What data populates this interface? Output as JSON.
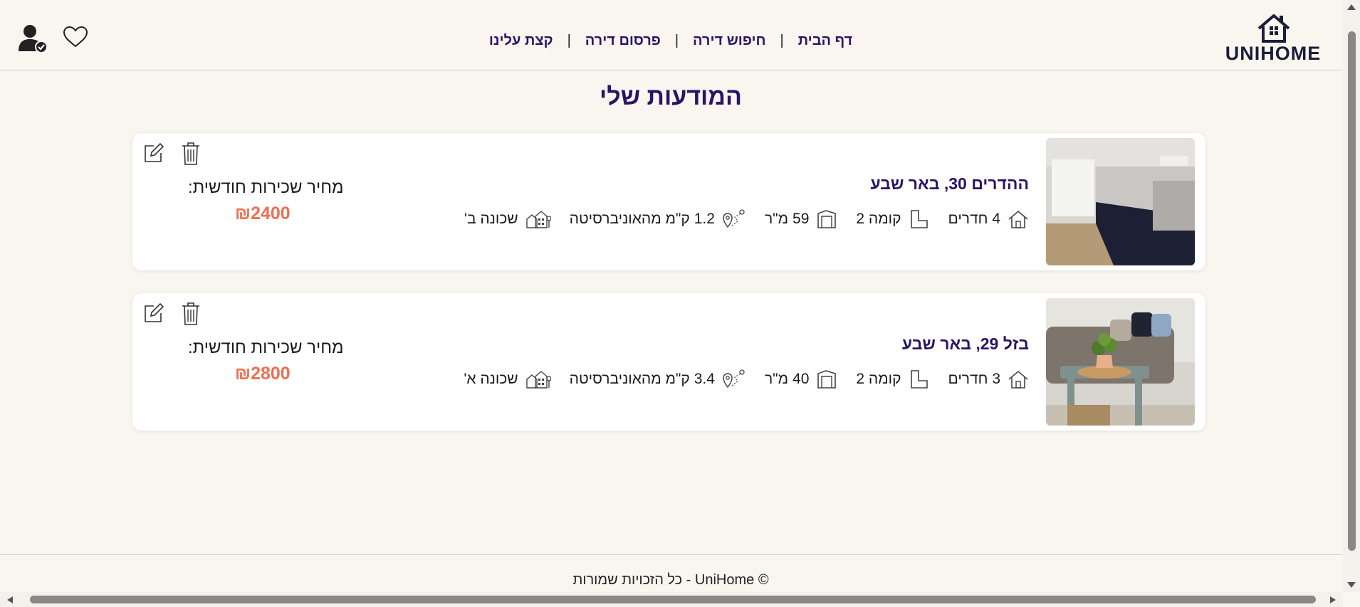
{
  "header": {
    "logo_text": "UNIHOME",
    "nav": [
      {
        "label": "דף הבית"
      },
      {
        "label": "חיפוש דירה"
      },
      {
        "label": "פרסום דירה"
      },
      {
        "label": "קצת עלינו"
      }
    ],
    "separator": "|",
    "icons": {
      "user": "user-check-icon",
      "favorites": "heart-icon"
    }
  },
  "page_title": "המודעות שלי",
  "listings": [
    {
      "address": "ההדרים 30, באר שבע",
      "rooms": "4 חדרים",
      "floor": "קומה 2",
      "area_value": "59",
      "area_unit": "מ\"ר",
      "distance_value": "1.2",
      "distance_text": "ק\"מ מהאוניברסיטה",
      "neighborhood": "שכונה ב'",
      "price_label": "מחיר שכירות חודשית:",
      "price": "₪2400"
    },
    {
      "address": "בזל 29, באר שבע",
      "rooms": "3 חדרים",
      "floor": "קומה 2",
      "area_value": "40",
      "area_unit": "מ\"ר",
      "distance_value": "3.4",
      "distance_text": "ק\"מ מהאוניברסיטה",
      "neighborhood": "שכונה א'",
      "price_label": "מחיר שכירות חודשית:",
      "price": "₪2800"
    }
  ],
  "footer": "© UniHome - כל הזכויות שמורות",
  "colors": {
    "background": "#f9f5ef",
    "accent": "#2a1466",
    "price": "#ee6f52",
    "card": "#ffffff"
  }
}
